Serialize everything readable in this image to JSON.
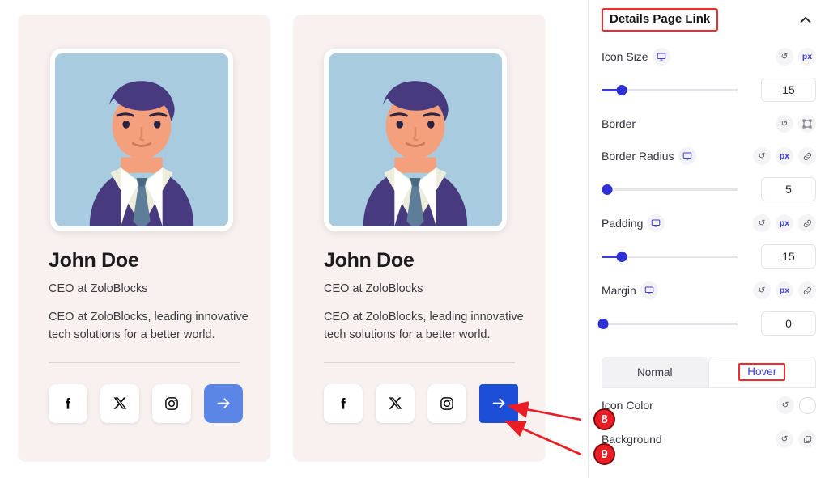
{
  "cards": [
    {
      "name": "John Doe",
      "role": "CEO at ZoloBlocks",
      "bio": "CEO at ZoloBlocks, leading innovative tech solutions for a better world.",
      "socials": [
        "facebook-icon",
        "x-twitter-icon",
        "instagram-icon"
      ],
      "cta_icon": "arrow-right-icon",
      "cta_state": "normal"
    },
    {
      "name": "John Doe",
      "role": "CEO at ZoloBlocks",
      "bio": "CEO at ZoloBlocks, leading innovative tech solutions for a better world.",
      "socials": [
        "facebook-icon",
        "x-twitter-icon",
        "instagram-icon"
      ],
      "cta_icon": "arrow-right-icon",
      "cta_state": "hover"
    }
  ],
  "panel": {
    "title": "Details Page Link",
    "collapse_icon": "chevron-up-icon",
    "controls": [
      {
        "label": "Icon Size",
        "device_icon": "desktop-icon",
        "reset_icon": "reset-icon",
        "unit": "px",
        "link_icon": null,
        "value": "15",
        "slider_percent": 15
      },
      {
        "label": "Border",
        "device_icon": null,
        "reset_icon": "reset-icon",
        "unit": null,
        "link_icon": "border-frame-icon",
        "value": null,
        "slider_percent": null
      },
      {
        "label": "Border Radius",
        "device_icon": "desktop-icon",
        "reset_icon": "reset-icon",
        "unit": "px",
        "link_icon": "link-icon",
        "value": "5",
        "slider_percent": 4
      },
      {
        "label": "Padding",
        "device_icon": "desktop-icon",
        "reset_icon": "reset-icon",
        "unit": "px",
        "link_icon": "link-icon",
        "value": "15",
        "slider_percent": 15
      },
      {
        "label": "Margin",
        "device_icon": "desktop-icon",
        "reset_icon": "reset-icon",
        "unit": "px",
        "link_icon": "link-icon",
        "value": "0",
        "slider_percent": 0
      }
    ],
    "tabs": [
      {
        "label": "Normal",
        "active": false,
        "highlighted": false
      },
      {
        "label": "Hover",
        "active": true,
        "highlighted": true
      }
    ],
    "props": [
      {
        "label": "Icon Color",
        "reset_icon": "reset-icon",
        "control_icon": "color-swatch"
      },
      {
        "label": "Background",
        "reset_icon": "reset-icon",
        "control_icon": "layers-icon"
      }
    ]
  },
  "annotations": [
    {
      "number": "8",
      "target": "details-page-link-hover-icon-color"
    },
    {
      "number": "9",
      "target": "details-page-link-hover-background"
    }
  ],
  "colors": {
    "accent_blue": "#3d3ddb",
    "cta_normal": "#5b86e5",
    "cta_hover": "#1d4ed8",
    "annotation_red": "#ec1c24",
    "card_bg": "#f8f1f0"
  }
}
